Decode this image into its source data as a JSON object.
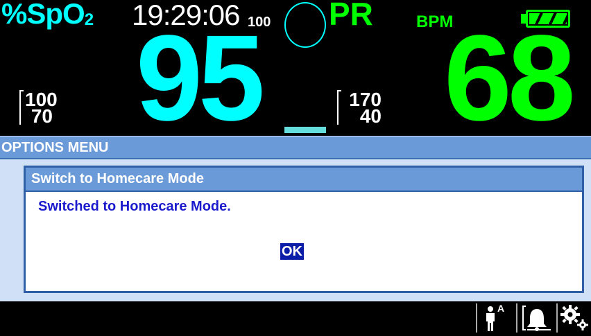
{
  "vitals": {
    "spo2": {
      "label_main": "%SpO",
      "label_sub": "2",
      "value": "95",
      "limit_high": "100",
      "limit_low": "70",
      "color": "#00ffff"
    },
    "clock": "19:29:06",
    "pulse_amplitude_scale": "100",
    "pulse_rate": {
      "label": "PR",
      "unit": "BPM",
      "value": "68",
      "limit_high": "170",
      "limit_low": "40",
      "color": "#00ff00"
    }
  },
  "menu": {
    "title": "OPTIONS MENU",
    "dialog": {
      "title": "Switch to Homecare Mode",
      "message": "Switched to Homecare Mode.",
      "ok_label": "OK"
    }
  },
  "status_icons": {
    "patient_mode_letter": "A",
    "icons": [
      "patient-adult-icon",
      "alarm-bell-icon",
      "settings-gears-icon"
    ]
  },
  "colors": {
    "menu_header": "#6b9ad8",
    "menu_body": "#cfe0f7",
    "dialog_border": "#2f5fa7",
    "message_text": "#1a1acc",
    "ok_button": "#0b1ea8"
  }
}
